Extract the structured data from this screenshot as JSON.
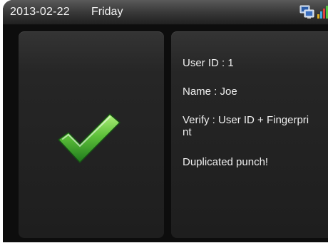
{
  "status_bar": {
    "date": "2013-02-22",
    "day": "Friday",
    "icons": [
      "network-icon",
      "signal-icon"
    ]
  },
  "result": {
    "icon": "check-icon",
    "accent": "#5ec13a"
  },
  "info": {
    "user_id": "User ID : 1",
    "name": "Name : Joe",
    "verify_line1": "Verify : User ID + Fingerpri",
    "verify_line2": "nt",
    "message": "Duplicated punch!"
  }
}
